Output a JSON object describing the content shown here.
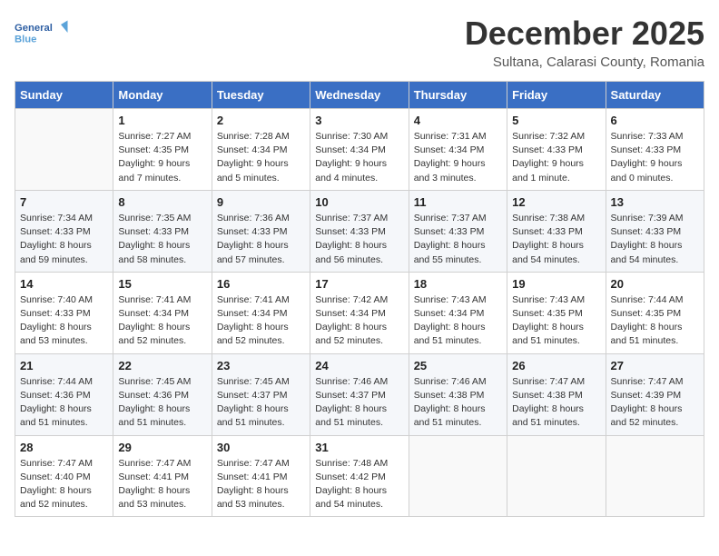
{
  "header": {
    "logo_line1": "General",
    "logo_line2": "Blue",
    "month": "December 2025",
    "location": "Sultana, Calarasi County, Romania"
  },
  "days_of_week": [
    "Sunday",
    "Monday",
    "Tuesday",
    "Wednesday",
    "Thursday",
    "Friday",
    "Saturday"
  ],
  "weeks": [
    [
      {
        "day": "",
        "info": ""
      },
      {
        "day": "1",
        "info": "Sunrise: 7:27 AM\nSunset: 4:35 PM\nDaylight: 9 hours\nand 7 minutes."
      },
      {
        "day": "2",
        "info": "Sunrise: 7:28 AM\nSunset: 4:34 PM\nDaylight: 9 hours\nand 5 minutes."
      },
      {
        "day": "3",
        "info": "Sunrise: 7:30 AM\nSunset: 4:34 PM\nDaylight: 9 hours\nand 4 minutes."
      },
      {
        "day": "4",
        "info": "Sunrise: 7:31 AM\nSunset: 4:34 PM\nDaylight: 9 hours\nand 3 minutes."
      },
      {
        "day": "5",
        "info": "Sunrise: 7:32 AM\nSunset: 4:33 PM\nDaylight: 9 hours\nand 1 minute."
      },
      {
        "day": "6",
        "info": "Sunrise: 7:33 AM\nSunset: 4:33 PM\nDaylight: 9 hours\nand 0 minutes."
      }
    ],
    [
      {
        "day": "7",
        "info": "Sunrise: 7:34 AM\nSunset: 4:33 PM\nDaylight: 8 hours\nand 59 minutes."
      },
      {
        "day": "8",
        "info": "Sunrise: 7:35 AM\nSunset: 4:33 PM\nDaylight: 8 hours\nand 58 minutes."
      },
      {
        "day": "9",
        "info": "Sunrise: 7:36 AM\nSunset: 4:33 PM\nDaylight: 8 hours\nand 57 minutes."
      },
      {
        "day": "10",
        "info": "Sunrise: 7:37 AM\nSunset: 4:33 PM\nDaylight: 8 hours\nand 56 minutes."
      },
      {
        "day": "11",
        "info": "Sunrise: 7:37 AM\nSunset: 4:33 PM\nDaylight: 8 hours\nand 55 minutes."
      },
      {
        "day": "12",
        "info": "Sunrise: 7:38 AM\nSunset: 4:33 PM\nDaylight: 8 hours\nand 54 minutes."
      },
      {
        "day": "13",
        "info": "Sunrise: 7:39 AM\nSunset: 4:33 PM\nDaylight: 8 hours\nand 54 minutes."
      }
    ],
    [
      {
        "day": "14",
        "info": "Sunrise: 7:40 AM\nSunset: 4:33 PM\nDaylight: 8 hours\nand 53 minutes."
      },
      {
        "day": "15",
        "info": "Sunrise: 7:41 AM\nSunset: 4:34 PM\nDaylight: 8 hours\nand 52 minutes."
      },
      {
        "day": "16",
        "info": "Sunrise: 7:41 AM\nSunset: 4:34 PM\nDaylight: 8 hours\nand 52 minutes."
      },
      {
        "day": "17",
        "info": "Sunrise: 7:42 AM\nSunset: 4:34 PM\nDaylight: 8 hours\nand 52 minutes."
      },
      {
        "day": "18",
        "info": "Sunrise: 7:43 AM\nSunset: 4:34 PM\nDaylight: 8 hours\nand 51 minutes."
      },
      {
        "day": "19",
        "info": "Sunrise: 7:43 AM\nSunset: 4:35 PM\nDaylight: 8 hours\nand 51 minutes."
      },
      {
        "day": "20",
        "info": "Sunrise: 7:44 AM\nSunset: 4:35 PM\nDaylight: 8 hours\nand 51 minutes."
      }
    ],
    [
      {
        "day": "21",
        "info": "Sunrise: 7:44 AM\nSunset: 4:36 PM\nDaylight: 8 hours\nand 51 minutes."
      },
      {
        "day": "22",
        "info": "Sunrise: 7:45 AM\nSunset: 4:36 PM\nDaylight: 8 hours\nand 51 minutes."
      },
      {
        "day": "23",
        "info": "Sunrise: 7:45 AM\nSunset: 4:37 PM\nDaylight: 8 hours\nand 51 minutes."
      },
      {
        "day": "24",
        "info": "Sunrise: 7:46 AM\nSunset: 4:37 PM\nDaylight: 8 hours\nand 51 minutes."
      },
      {
        "day": "25",
        "info": "Sunrise: 7:46 AM\nSunset: 4:38 PM\nDaylight: 8 hours\nand 51 minutes."
      },
      {
        "day": "26",
        "info": "Sunrise: 7:47 AM\nSunset: 4:38 PM\nDaylight: 8 hours\nand 51 minutes."
      },
      {
        "day": "27",
        "info": "Sunrise: 7:47 AM\nSunset: 4:39 PM\nDaylight: 8 hours\nand 52 minutes."
      }
    ],
    [
      {
        "day": "28",
        "info": "Sunrise: 7:47 AM\nSunset: 4:40 PM\nDaylight: 8 hours\nand 52 minutes."
      },
      {
        "day": "29",
        "info": "Sunrise: 7:47 AM\nSunset: 4:41 PM\nDaylight: 8 hours\nand 53 minutes."
      },
      {
        "day": "30",
        "info": "Sunrise: 7:47 AM\nSunset: 4:41 PM\nDaylight: 8 hours\nand 53 minutes."
      },
      {
        "day": "31",
        "info": "Sunrise: 7:48 AM\nSunset: 4:42 PM\nDaylight: 8 hours\nand 54 minutes."
      },
      {
        "day": "",
        "info": ""
      },
      {
        "day": "",
        "info": ""
      },
      {
        "day": "",
        "info": ""
      }
    ]
  ]
}
